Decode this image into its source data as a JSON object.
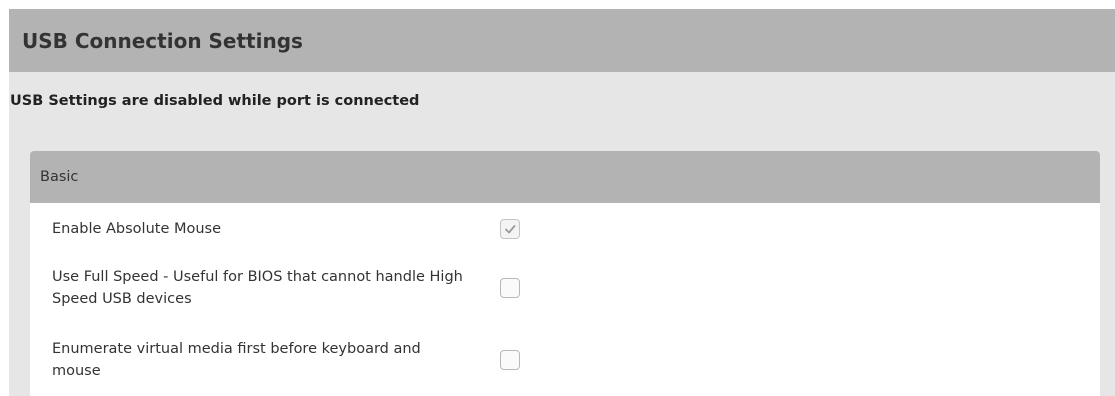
{
  "header": {
    "title": "USB Connection Settings"
  },
  "notice": "USB Settings are disabled while port is connected",
  "panel": {
    "title": "Basic",
    "rows": [
      {
        "label": "Enable Absolute Mouse",
        "checked": true,
        "disabled": true
      },
      {
        "label": "Use Full Speed - Useful for BIOS that cannot handle High Speed USB devices",
        "checked": false,
        "disabled": true
      },
      {
        "label": "Enumerate virtual media first before keyboard and mouse",
        "checked": false,
        "disabled": true
      }
    ]
  }
}
